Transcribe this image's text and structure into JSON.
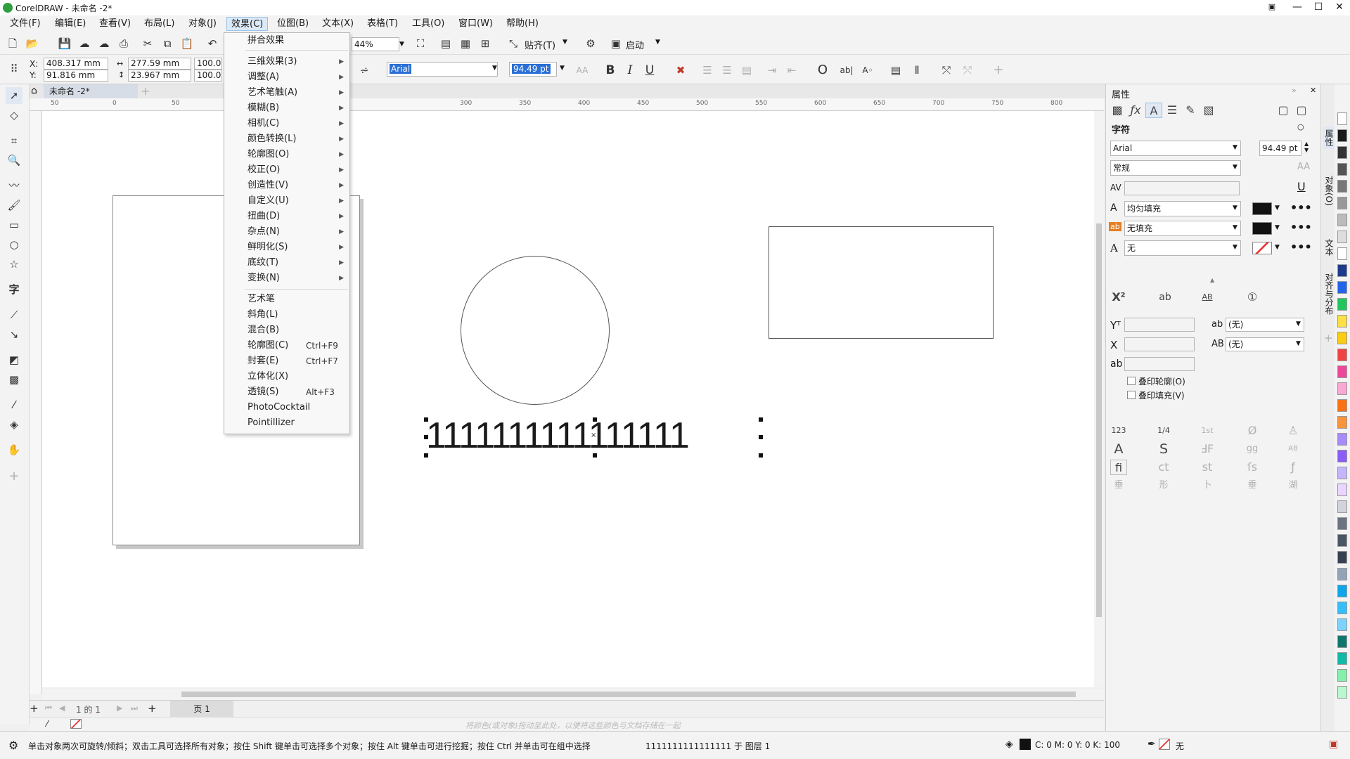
{
  "window": {
    "title": "CorelDRAW - 未命名 -2*"
  },
  "menu": [
    "文件(F)",
    "编辑(E)",
    "查看(V)",
    "布局(L)",
    "对象(J)",
    "效果(C)",
    "位图(B)",
    "文本(X)",
    "表格(T)",
    "工具(O)",
    "窗口(W)",
    "帮助(H)"
  ],
  "toolbar": {
    "zoom": "44%",
    "snap_label": "贴齐(T)",
    "launch_label": "启动"
  },
  "propbar": {
    "x": "408.317 mm",
    "y": "91.816 mm",
    "w": "277.59 mm",
    "h": "23.967 mm",
    "sx": "100.0",
    "sy": "100.0",
    "font": "Arial",
    "size": "94.49 pt"
  },
  "doc_tab": "未命名 -2*",
  "ruler_h": [
    "50",
    "0",
    "50",
    "300",
    "350",
    "400",
    "450",
    "500",
    "550",
    "600",
    "650",
    "700",
    "750",
    "800"
  ],
  "canvas_text": "1111111111111111",
  "dropdown": {
    "top": "拼合效果",
    "submenus": [
      "三维效果(3)",
      "调整(A)",
      "艺术笔触(A)",
      "模糊(B)",
      "相机(C)",
      "颜色转换(L)",
      "轮廓图(O)",
      "校正(O)",
      "创造性(V)",
      "自定义(U)",
      "扭曲(D)",
      "杂点(N)",
      "鲜明化(S)",
      "底纹(T)",
      "变换(N)"
    ],
    "items": [
      {
        "label": "艺术笔",
        "shortcut": ""
      },
      {
        "label": "斜角(L)",
        "shortcut": ""
      },
      {
        "label": "混合(B)",
        "shortcut": ""
      },
      {
        "label": "轮廓图(C)",
        "shortcut": "Ctrl+F9"
      },
      {
        "label": "封套(E)",
        "shortcut": "Ctrl+F7"
      },
      {
        "label": "立体化(X)",
        "shortcut": ""
      },
      {
        "label": "透镜(S)",
        "shortcut": "Alt+F3"
      },
      {
        "label": "PhotoCocktail",
        "shortcut": ""
      },
      {
        "label": "Pointillizer",
        "shortcut": ""
      }
    ]
  },
  "pagebar": {
    "pages": "1 的 1",
    "page_tab": "页 1"
  },
  "colorbar_hint": "将颜色(或对象)拖动至此处，以便将这些颜色与文档存储在一起",
  "status": {
    "hint": "单击对象两次可旋转/倾斜；双击工具可选择所有对象；按住 Shift 键单击可选择多个对象；按住 Alt 键单击可进行挖掘；按住 Ctrl 并单击可在组中选择",
    "object": "1111111111111111 于 图层 1",
    "cmyk": "C: 0 M: 0 Y: 0 K: 100",
    "outline": "无"
  },
  "props": {
    "title": "属性",
    "section": "字符",
    "font": "Arial",
    "size": "94.49 pt",
    "style": "常规",
    "fill1": "均匀填充",
    "fill2": "无填充",
    "outline": "无",
    "opt1": "(无)",
    "opt2": "(无)",
    "overprint_outline": "叠印轮廓(O)",
    "overprint_fill": "叠印填充(V)"
  },
  "sidetabs": [
    "属性",
    "对象(O)",
    "文本",
    "对齐与分布"
  ],
  "palette": [
    "#ffffff",
    "#1a1a1a",
    "#333333",
    "#555555",
    "#777777",
    "#999999",
    "#bbbbbb",
    "#dddddd",
    "#ffffff",
    "#1e3a8a",
    "#2563eb",
    "#22c55e",
    "#fde047",
    "#facc15",
    "#ef4444",
    "#ec4899",
    "#f9a8d4",
    "#f97316",
    "#fb923c",
    "#a78bfa",
    "#8b5cf6",
    "#c4b5fd",
    "#e9d5ff",
    "#d1d5db",
    "#6b7280",
    "#4b5563",
    "#374151",
    "#94a3b8",
    "#0ea5e9",
    "#38bdf8",
    "#7dd3fc",
    "#0f766e",
    "#14b8a6",
    "#86efac",
    "#bbf7d0"
  ]
}
